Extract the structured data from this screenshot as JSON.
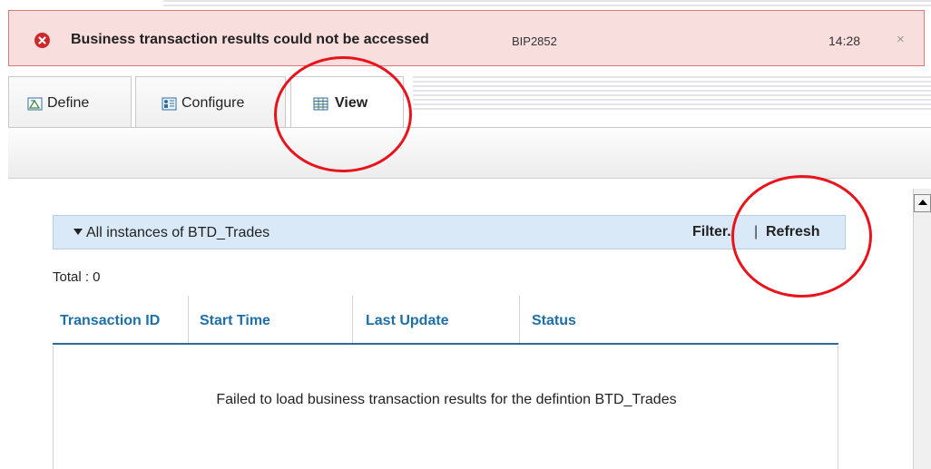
{
  "banner": {
    "title": "Business transaction results could not be accessed",
    "code": "BIP2852",
    "time": "14:28",
    "close": "×"
  },
  "tabs": [
    {
      "label": "Define",
      "icon": "define-icon"
    },
    {
      "label": "Configure",
      "icon": "configure-icon"
    },
    {
      "label": "View",
      "icon": "table-icon",
      "active": true
    }
  ],
  "section": {
    "title": "All instances of BTD_Trades",
    "filter_label": "Filter..",
    "separator": "|",
    "refresh_label": "Refresh"
  },
  "total": "Total : 0",
  "table": {
    "columns": [
      "Transaction ID",
      "Start Time",
      "Last Update",
      "Status"
    ],
    "empty_message": "Failed to load business transaction results for the defintion BTD_Trades"
  },
  "colors": {
    "error": "#cc2a2a",
    "banner_bg": "#f9dede",
    "header_link": "#1e6fa8",
    "annotation": "#e8141c"
  }
}
